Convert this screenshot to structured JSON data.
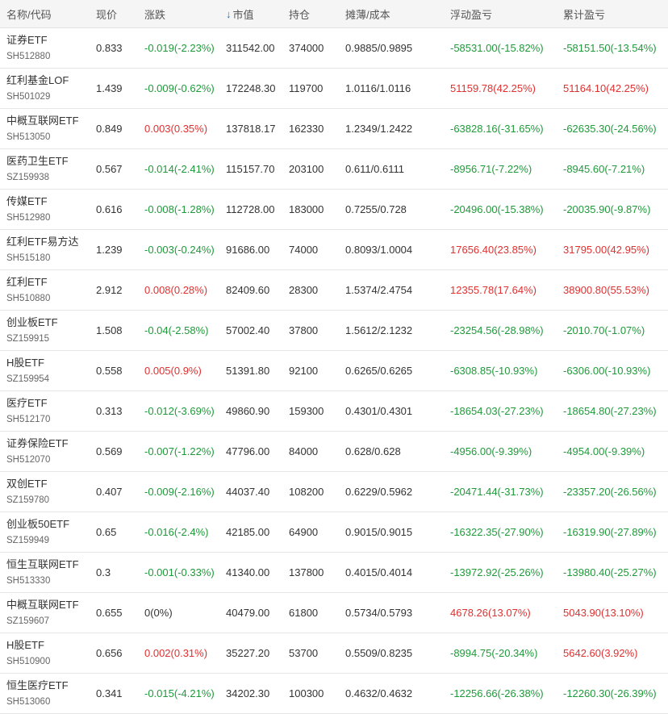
{
  "header": {
    "name": "名称/代码",
    "price": "现价",
    "change": "涨跌",
    "market_value": "市值",
    "holding": "持仓",
    "cost": "摊薄/成本",
    "floating_pl": "浮动盈亏",
    "accum_pl": "累计盈亏",
    "sort_icon": "arrow-down-icon",
    "sort_arrow": "↓"
  },
  "colors": {
    "up": "#e03030",
    "down": "#1f9a3a",
    "sort": "#1a73c8"
  },
  "rows": [
    {
      "name": "证券ETF",
      "code": "SH512880",
      "price": "0.833",
      "change": "-0.019(-2.23%)",
      "change_dir": "down",
      "market_value": "311542.00",
      "holding": "374000",
      "cost": "0.9885/0.9895",
      "floating": "-58531.00(-15.82%)",
      "floating_dir": "down",
      "accum": "-58151.50(-13.54%)",
      "accum_dir": "down"
    },
    {
      "name": "红利基金LOF",
      "code": "SH501029",
      "price": "1.439",
      "change": "-0.009(-0.62%)",
      "change_dir": "down",
      "market_value": "172248.30",
      "holding": "119700",
      "cost": "1.0116/1.0116",
      "floating": "51159.78(42.25%)",
      "floating_dir": "up",
      "accum": "51164.10(42.25%)",
      "accum_dir": "up"
    },
    {
      "name": "中概互联网ETF",
      "code": "SH513050",
      "price": "0.849",
      "change": "0.003(0.35%)",
      "change_dir": "up",
      "market_value": "137818.17",
      "holding": "162330",
      "cost": "1.2349/1.2422",
      "floating": "-63828.16(-31.65%)",
      "floating_dir": "down",
      "accum": "-62635.30(-24.56%)",
      "accum_dir": "down"
    },
    {
      "name": "医药卫生ETF",
      "code": "SZ159938",
      "price": "0.567",
      "change": "-0.014(-2.41%)",
      "change_dir": "down",
      "market_value": "115157.70",
      "holding": "203100",
      "cost": "0.611/0.6111",
      "floating": "-8956.71(-7.22%)",
      "floating_dir": "down",
      "accum": "-8945.60(-7.21%)",
      "accum_dir": "down"
    },
    {
      "name": "传媒ETF",
      "code": "SH512980",
      "price": "0.616",
      "change": "-0.008(-1.28%)",
      "change_dir": "down",
      "market_value": "112728.00",
      "holding": "183000",
      "cost": "0.7255/0.728",
      "floating": "-20496.00(-15.38%)",
      "floating_dir": "down",
      "accum": "-20035.90(-9.87%)",
      "accum_dir": "down"
    },
    {
      "name": "红利ETF易方达",
      "code": "SH515180",
      "price": "1.239",
      "change": "-0.003(-0.24%)",
      "change_dir": "down",
      "market_value": "91686.00",
      "holding": "74000",
      "cost": "0.8093/1.0004",
      "floating": "17656.40(23.85%)",
      "floating_dir": "up",
      "accum": "31795.00(42.95%)",
      "accum_dir": "up"
    },
    {
      "name": "红利ETF",
      "code": "SH510880",
      "price": "2.912",
      "change": "0.008(0.28%)",
      "change_dir": "up",
      "market_value": "82409.60",
      "holding": "28300",
      "cost": "1.5374/2.4754",
      "floating": "12355.78(17.64%)",
      "floating_dir": "up",
      "accum": "38900.80(55.53%)",
      "accum_dir": "up"
    },
    {
      "name": "创业板ETF",
      "code": "SZ159915",
      "price": "1.508",
      "change": "-0.04(-2.58%)",
      "change_dir": "down",
      "market_value": "57002.40",
      "holding": "37800",
      "cost": "1.5612/2.1232",
      "floating": "-23254.56(-28.98%)",
      "floating_dir": "down",
      "accum": "-2010.70(-1.07%)",
      "accum_dir": "down"
    },
    {
      "name": "H股ETF",
      "code": "SZ159954",
      "price": "0.558",
      "change": "0.005(0.9%)",
      "change_dir": "up",
      "market_value": "51391.80",
      "holding": "92100",
      "cost": "0.6265/0.6265",
      "floating": "-6308.85(-10.93%)",
      "floating_dir": "down",
      "accum": "-6306.00(-10.93%)",
      "accum_dir": "down"
    },
    {
      "name": "医疗ETF",
      "code": "SH512170",
      "price": "0.313",
      "change": "-0.012(-3.69%)",
      "change_dir": "down",
      "market_value": "49860.90",
      "holding": "159300",
      "cost": "0.4301/0.4301",
      "floating": "-18654.03(-27.23%)",
      "floating_dir": "down",
      "accum": "-18654.80(-27.23%)",
      "accum_dir": "down"
    },
    {
      "name": "证券保险ETF",
      "code": "SH512070",
      "price": "0.569",
      "change": "-0.007(-1.22%)",
      "change_dir": "down",
      "market_value": "47796.00",
      "holding": "84000",
      "cost": "0.628/0.628",
      "floating": "-4956.00(-9.39%)",
      "floating_dir": "down",
      "accum": "-4954.00(-9.39%)",
      "accum_dir": "down"
    },
    {
      "name": "双创ETF",
      "code": "SZ159780",
      "price": "0.407",
      "change": "-0.009(-2.16%)",
      "change_dir": "down",
      "market_value": "44037.40",
      "holding": "108200",
      "cost": "0.6229/0.5962",
      "floating": "-20471.44(-31.73%)",
      "floating_dir": "down",
      "accum": "-23357.20(-26.56%)",
      "accum_dir": "down"
    },
    {
      "name": "创业板50ETF",
      "code": "SZ159949",
      "price": "0.65",
      "change": "-0.016(-2.4%)",
      "change_dir": "down",
      "market_value": "42185.00",
      "holding": "64900",
      "cost": "0.9015/0.9015",
      "floating": "-16322.35(-27.90%)",
      "floating_dir": "down",
      "accum": "-16319.90(-27.89%)",
      "accum_dir": "down"
    },
    {
      "name": "恒生互联网ETF",
      "code": "SH513330",
      "price": "0.3",
      "change": "-0.001(-0.33%)",
      "change_dir": "down",
      "market_value": "41340.00",
      "holding": "137800",
      "cost": "0.4015/0.4014",
      "floating": "-13972.92(-25.26%)",
      "floating_dir": "down",
      "accum": "-13980.40(-25.27%)",
      "accum_dir": "down"
    },
    {
      "name": "中概互联网ETF",
      "code": "SZ159607",
      "price": "0.655",
      "change": "0(0%)",
      "change_dir": "flat",
      "market_value": "40479.00",
      "holding": "61800",
      "cost": "0.5734/0.5793",
      "floating": "4678.26(13.07%)",
      "floating_dir": "up",
      "accum": "5043.90(13.10%)",
      "accum_dir": "up"
    },
    {
      "name": "H股ETF",
      "code": "SH510900",
      "price": "0.656",
      "change": "0.002(0.31%)",
      "change_dir": "up",
      "market_value": "35227.20",
      "holding": "53700",
      "cost": "0.5509/0.8235",
      "floating": "-8994.75(-20.34%)",
      "floating_dir": "down",
      "accum": "5642.60(3.92%)",
      "accum_dir": "up"
    },
    {
      "name": "恒生医疗ETF",
      "code": "SH513060",
      "price": "0.341",
      "change": "-0.015(-4.21%)",
      "change_dir": "down",
      "market_value": "34202.30",
      "holding": "100300",
      "cost": "0.4632/0.4632",
      "floating": "-12256.66(-26.38%)",
      "floating_dir": "down",
      "accum": "-12260.30(-26.39%)",
      "accum_dir": "down"
    }
  ]
}
